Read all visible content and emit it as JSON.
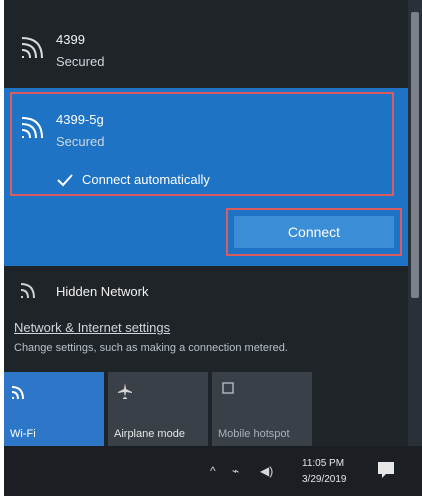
{
  "networks": [
    {
      "ssid": "4399",
      "status": "Secured"
    },
    {
      "ssid": "4399-5g",
      "status": "Secured",
      "auto_connect": "Connect automatically",
      "action": "Connect"
    }
  ],
  "hidden_network": "Hidden Network",
  "settings": {
    "title": "Network & Internet settings",
    "subtitle": "Change settings, such as making a connection metered."
  },
  "quick_actions": [
    {
      "label": "Wi-Fi",
      "icon": "wifi-icon"
    },
    {
      "label": "Airplane mode",
      "icon": "airplane-icon"
    },
    {
      "label": "Mobile hotspot",
      "icon": "hotspot-icon"
    }
  ],
  "taskbar": {
    "time": "11:05 PM",
    "date": "3/29/2019"
  },
  "colors": {
    "panel": "#1f2429",
    "selected": "#1e73c4",
    "button": "#3b8ed6",
    "highlight": "#d95c63",
    "tile_active": "#2e77c8",
    "tile_inactive": "#3a4047"
  }
}
